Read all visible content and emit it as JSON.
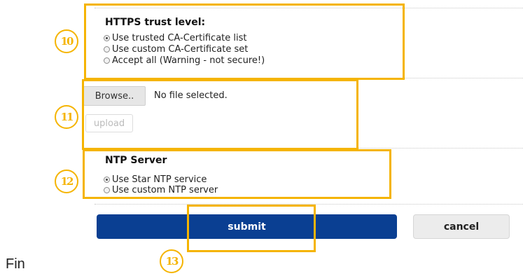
{
  "https": {
    "heading": "HTTPS trust level:",
    "options": [
      {
        "label": "Use trusted CA-Certificate list",
        "selected": true
      },
      {
        "label": "Use custom CA-Certificate set",
        "selected": false
      },
      {
        "label": "Accept all (Warning - not secure!)",
        "selected": false
      }
    ],
    "callout_number": "10"
  },
  "upload": {
    "browse_label": "Browse..",
    "file_status": "No file selected.",
    "upload_label": "upload",
    "callout_number": "11"
  },
  "ntp": {
    "heading": "NTP Server",
    "options": [
      {
        "label": "Use Star NTP service",
        "selected": true
      },
      {
        "label": "Use custom NTP server",
        "selected": false
      }
    ],
    "callout_number": "12"
  },
  "actions": {
    "submit_label": "submit",
    "cancel_label": "cancel",
    "callout_number": "13"
  },
  "footer": {
    "text": "Fin"
  },
  "colors": {
    "callout": "#f5b400",
    "submit_bg": "#0a3f92"
  }
}
